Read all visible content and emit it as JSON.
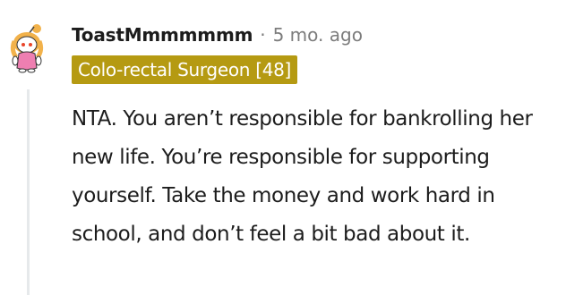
{
  "comment": {
    "username": "ToastMmmmmmm",
    "separator": "·",
    "timestamp": "5 mo. ago",
    "flair": "Colo-rectal Surgeon [48]",
    "body": "NTA. You aren’t responsible for bankrolling her new life. You’re responsible for supporting yourself. Take the money and work hard in school, and don’t feel a bit bad about it.",
    "avatar_icon": "snoo-avatar-icon"
  },
  "colors": {
    "flair_background": "#b59a12",
    "flair_text": "#ffffff",
    "meta_text": "#7c7c7c",
    "body_text": "#1c1c1c",
    "thread_line": "#e6e9eb"
  }
}
